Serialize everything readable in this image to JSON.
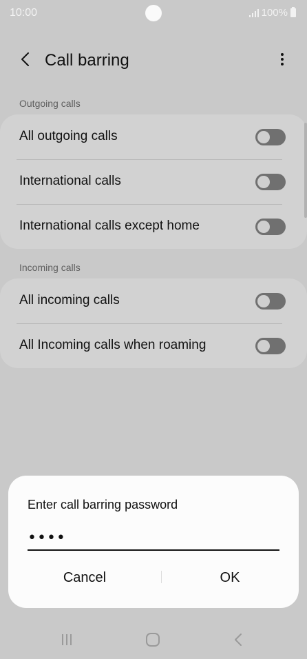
{
  "status_bar": {
    "time": "10:00",
    "battery": "100%"
  },
  "app_bar": {
    "title": "Call barring"
  },
  "outgoing": {
    "header": "Outgoing calls",
    "items": [
      {
        "label": "All outgoing calls",
        "on": false
      },
      {
        "label": "International calls",
        "on": false
      },
      {
        "label": "International calls except home",
        "on": false
      }
    ]
  },
  "incoming": {
    "header": "Incoming calls",
    "items": [
      {
        "label": "All incoming calls",
        "on": false
      },
      {
        "label": "All Incoming calls when roaming",
        "on": false
      }
    ]
  },
  "dialog": {
    "title": "Enter call barring password",
    "password_value": "••••",
    "cancel_label": "Cancel",
    "ok_label": "OK"
  },
  "nav_bar": {
    "icons": [
      "recents-icon",
      "home-icon",
      "back-icon"
    ]
  },
  "colors": {
    "background": "#c9c9c9",
    "dialog": "#fcfcfc",
    "toggle_off": "#707070"
  }
}
